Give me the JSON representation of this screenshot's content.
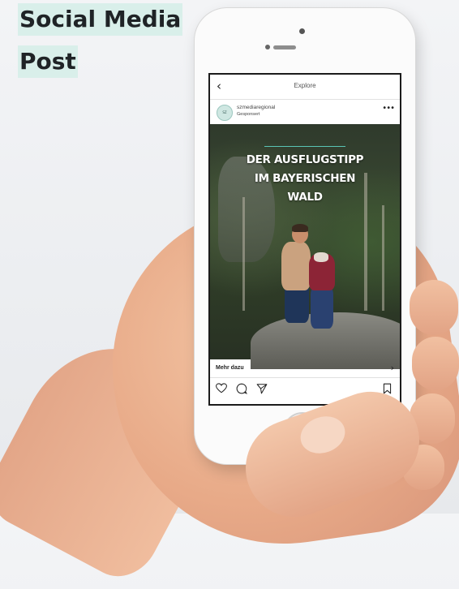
{
  "headline": {
    "line1": "Social Media",
    "line2": "Post"
  },
  "app": {
    "title": "Explore",
    "back_icon": "chevron-left-icon",
    "account_name": "szmediaregional",
    "sponsored_label": "Gesponsert",
    "avatar_text": "SZ",
    "more_icon": "more-horizontal-icon",
    "post_text_lines": [
      "DER AUSFLUGSTIPP",
      "IM BAYERISCHEN",
      "WALD"
    ],
    "cta_label": "Mehr dazu",
    "cta_icon": "chevron-right-icon",
    "action_icons": [
      "heart-icon",
      "comment-icon",
      "send-icon",
      "bookmark-icon"
    ]
  },
  "colors": {
    "headline_highlight": "#d9efea",
    "headline_text": "#1f2326",
    "accent_line": "#5ac4b5"
  }
}
